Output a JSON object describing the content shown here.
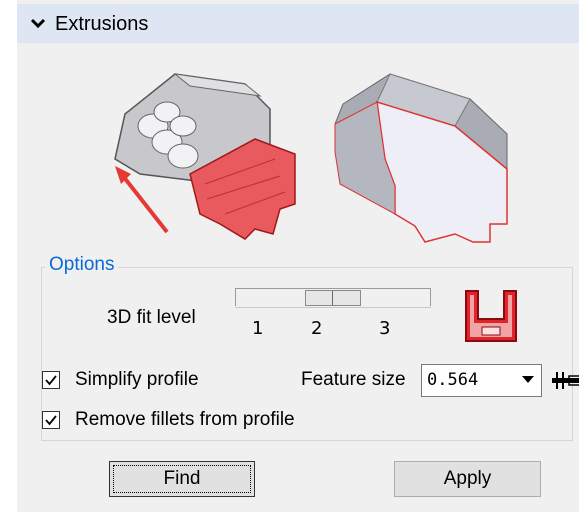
{
  "section": {
    "title": "Extrusions",
    "icon": "chevron-down-icon"
  },
  "preview": {
    "arrow_color": "#e53935",
    "highlight_color": "#e04848"
  },
  "options": {
    "legend": "Options",
    "fit_level": {
      "label": "3D fit level",
      "ticks": [
        "1",
        "2",
        "3"
      ],
      "selected": "2",
      "icon": "fit-level-profile-icon"
    },
    "simplify_profile": {
      "label": "Simplify profile",
      "checked": true
    },
    "remove_fillets": {
      "label": "Remove fillets from profile",
      "checked": true
    },
    "feature_size": {
      "label": "Feature size",
      "value": "0.564",
      "icon": "ruler-measure-icon"
    }
  },
  "buttons": {
    "find": "Find",
    "apply": "Apply"
  },
  "colors": {
    "header_bg": "#dfe6f3",
    "panel_bg": "#f0f0f0",
    "accent_blue": "#0b6ad7",
    "profile_red": "#e0242c"
  }
}
